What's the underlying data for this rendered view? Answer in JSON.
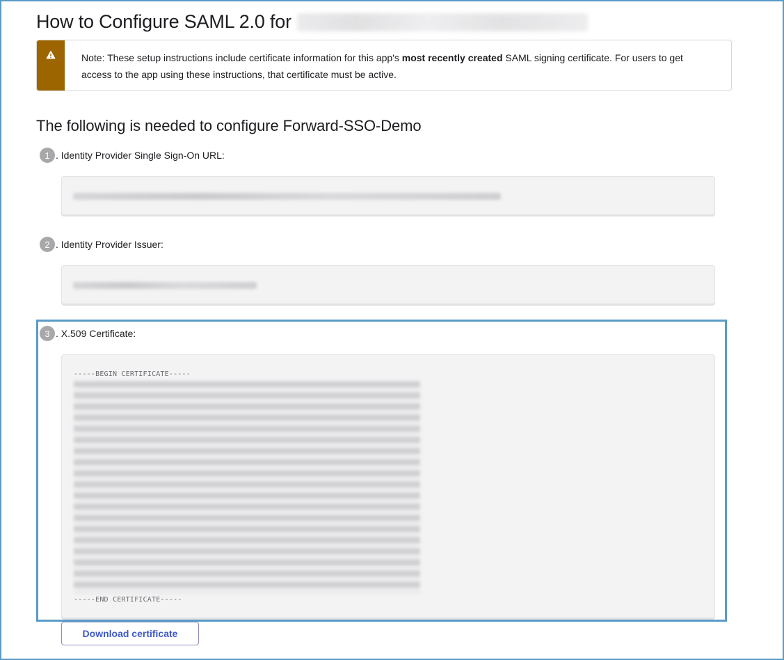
{
  "page": {
    "title": "How to Configure SAML 2.0 for"
  },
  "note": {
    "prefix": "Note: These setup instructions include certificate information for this app's ",
    "bold": "most recently created",
    "suffix": " SAML signing certificate. For users to get access to the app using these instructions, that certificate must be active."
  },
  "section": {
    "heading": "The following is needed to configure Forward-SSO-Demo"
  },
  "steps": [
    {
      "number": "1",
      "label": ". Identity Provider Single Sign-On URL:"
    },
    {
      "number": "2",
      "label": ". Identity Provider Issuer:"
    },
    {
      "number": "3",
      "label": ". X.509 Certificate:"
    }
  ],
  "certificate": {
    "begin": "-----BEGIN CERTIFICATE-----",
    "end": "-----END CERTIFICATE-----"
  },
  "actions": {
    "download_label": "Download certificate"
  },
  "colors": {
    "warning_bar": "#9c6500",
    "highlight": "#5a9bc7",
    "link": "#3f59c9"
  }
}
